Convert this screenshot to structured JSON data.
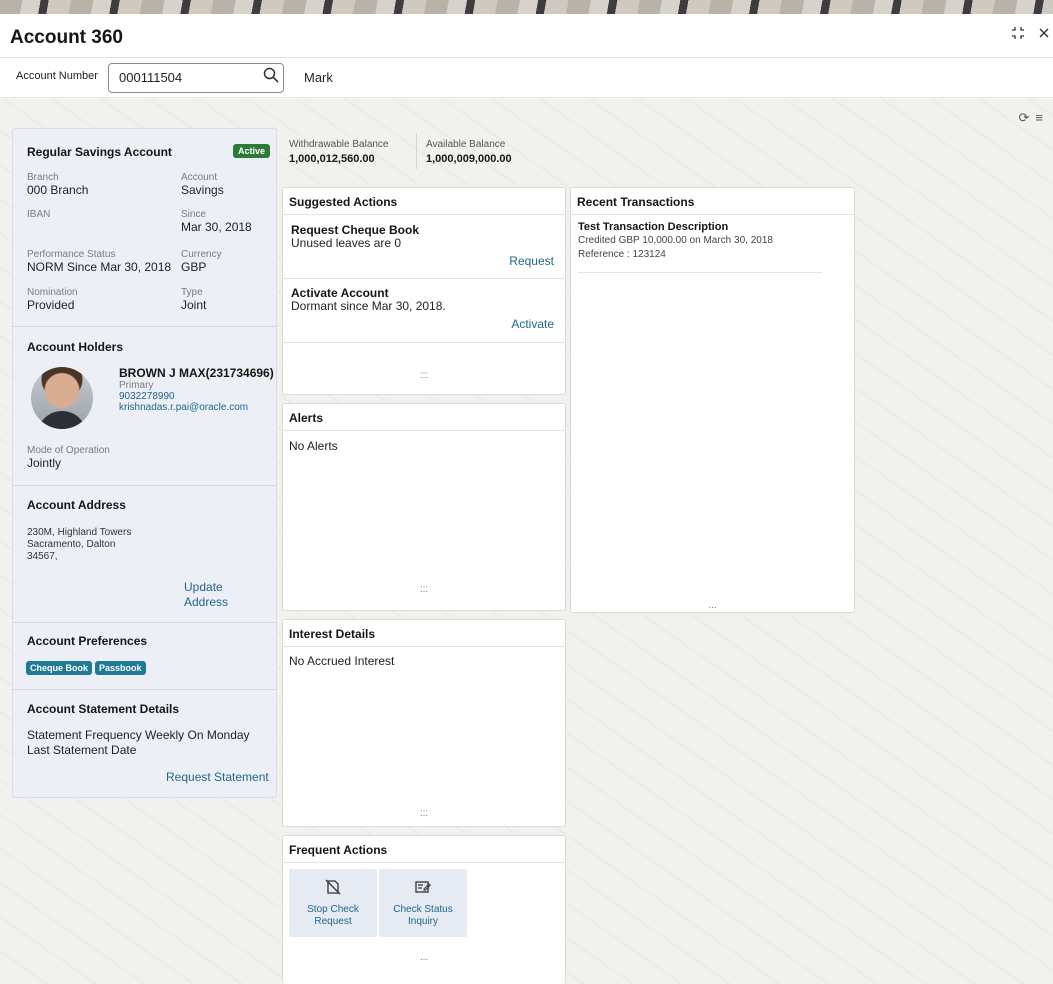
{
  "header": {
    "title": "Account 360"
  },
  "search": {
    "label": "Account Number",
    "value": "000111504",
    "customer_name": "Mark"
  },
  "account": {
    "type": "Regular Savings Account",
    "status": "Active",
    "fields": [
      {
        "label": "Branch",
        "value": "000 Branch"
      },
      {
        "label": "Account",
        "value": "Savings"
      },
      {
        "label": "IBAN",
        "value": ""
      },
      {
        "label": "Since",
        "value": "Mar 30, 2018"
      },
      {
        "label": "Performance Status",
        "value": "NORM Since Mar 30, 2018"
      },
      {
        "label": "Currency",
        "value": "GBP"
      },
      {
        "label": "Nomination",
        "value": "Provided"
      },
      {
        "label": "Type",
        "value": "Joint"
      }
    ]
  },
  "holders": {
    "title": "Account Holders",
    "name": "BROWN J MAX(231734696)",
    "role": "Primary",
    "phone": "9032278990",
    "email": "krishnadas.r.pai@oracle.com",
    "mode_label": "Mode of Operation",
    "mode_value": "Jointly"
  },
  "address": {
    "title": "Account Address",
    "line1": "230M, Highland Towers",
    "line2": "Sacramento, Dalton",
    "line3": "34567,",
    "update_line1": "Update",
    "update_line2": "Address"
  },
  "preferences": {
    "title": "Account Preferences",
    "badges": [
      "Cheque Book",
      "Passbook"
    ]
  },
  "statement": {
    "title": "Account Statement Details",
    "frequency": "Statement Frequency Weekly On Monday",
    "last": "Last Statement Date",
    "action": "Request Statement"
  },
  "balances": [
    {
      "label": "Withdrawable Balance",
      "value": "1,000,012,560.00"
    },
    {
      "label": "Available Balance",
      "value": "1,000,009,000.00"
    }
  ],
  "suggested": {
    "title": "Suggested Actions",
    "items": [
      {
        "title": "Request Cheque Book",
        "desc": "Unused leaves are 0",
        "action": "Request"
      },
      {
        "title": "Activate Account",
        "desc": "Dormant since Mar 30, 2018.",
        "action": "Activate"
      }
    ],
    "more": ":::"
  },
  "recent": {
    "title": "Recent Transactions",
    "txn_title": "Test Transaction Description",
    "txn_desc": "Credited GBP 10,000.00 on March 30, 2018",
    "txn_ref": "Reference : 123124",
    "more": "..."
  },
  "alerts": {
    "title": "Alerts",
    "empty": "No Alerts",
    "more": ":::"
  },
  "interest": {
    "title": "Interest Details",
    "empty": "No Accrued Interest",
    "more": ":::"
  },
  "frequent": {
    "title": "Frequent Actions",
    "tiles": [
      {
        "line1": "Stop Check",
        "line2": "Request",
        "icon": "stop-check-icon"
      },
      {
        "line1": "Check Status",
        "line2": "Inquiry",
        "icon": "check-status-icon"
      }
    ],
    "more": "..."
  }
}
